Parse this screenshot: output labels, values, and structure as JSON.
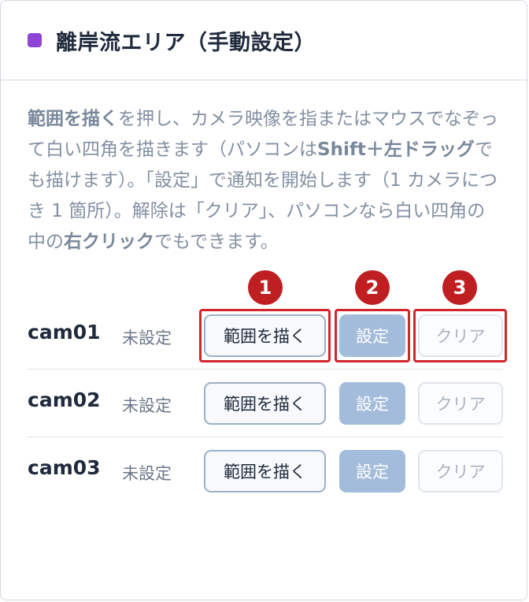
{
  "panel": {
    "title": "離岸流エリア（手動設定）",
    "title_dot_color": "#8e44d6",
    "title_dot_icon": "purple-square-icon"
  },
  "description": {
    "p1_bold": "範囲を描く",
    "p1": "を押し、カメラ映像を指またはマウスでなぞって白い四角を描きます（パソコンは",
    "p2_bold": "Shift＋左ドラッグ",
    "p2": "でも描けます）。「設定」で通知を開始します（1 カメラにつき 1 箇所）。解除は「クリア」、パソコンなら白い四角の中の",
    "p3_bold": "右クリック",
    "p3": "でもできます。"
  },
  "rows": [
    {
      "camera": "cam01",
      "status": "未設定",
      "draw_label": "範囲を描く",
      "set_label": "設定",
      "clear_label": "クリア"
    },
    {
      "camera": "cam02",
      "status": "未設定",
      "draw_label": "範囲を描く",
      "set_label": "設定",
      "clear_label": "クリア"
    },
    {
      "camera": "cam03",
      "status": "未設定",
      "draw_label": "範囲を描く",
      "set_label": "設定",
      "clear_label": "クリア"
    }
  ],
  "annotations": {
    "badge_1": "1",
    "badge_2": "2",
    "badge_3": "3",
    "highlight_color": "#d2262d",
    "badge_color": "#c01f22"
  }
}
